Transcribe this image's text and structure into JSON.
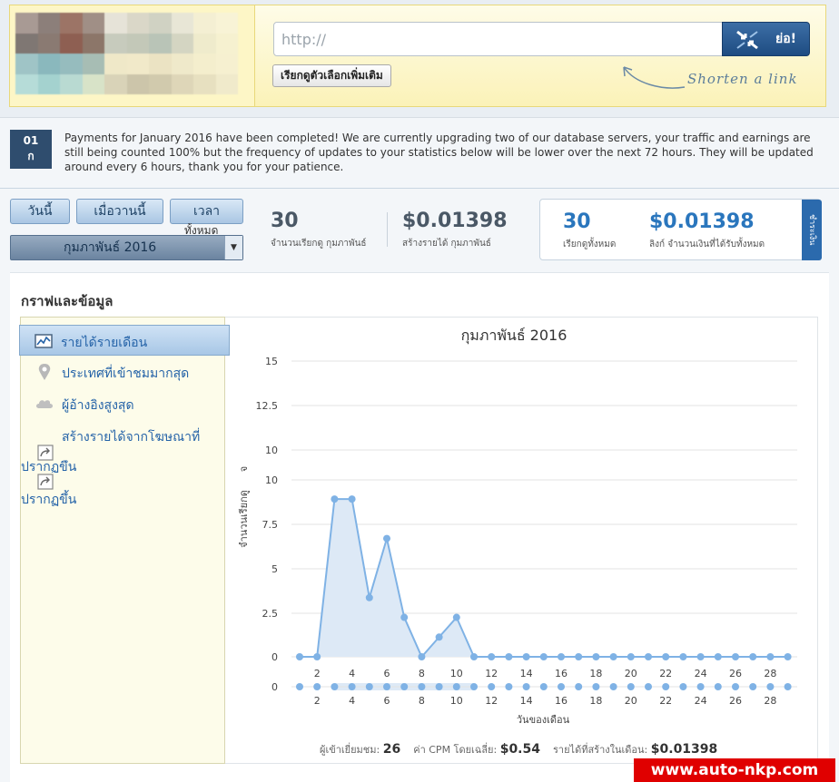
{
  "header": {
    "url_placeholder": "http://",
    "shorten_label": "ย่อ!",
    "more_options_label": "เรียกดูตัวเลือกเพิ่มเติม",
    "hint_text": "Shorten a link"
  },
  "notice": {
    "date_day": "01",
    "date_month": "ก",
    "text": "Payments for January 2016 have been completed! We are currently upgrading two of our database servers, your traffic and earnings are still being counted 100% but the frequency of updates to your statistics below will be lower over the next 72 hours. They will be updated around every 6 hours, thank you for your patience."
  },
  "stats": {
    "tabs": [
      "วันนี้",
      "เมื่อวานนี้",
      "เวลา"
    ],
    "tab_overflow": "ทั้งหมด",
    "month_selected": "กุมภาพันธ์ 2016",
    "month_clicks_value": "30",
    "month_clicks_label": "จำนวนเรียกดู กุมภาพันธ์",
    "month_earn_value": "$0.01398",
    "month_earn_label": "สร้างรายได้ กุมภาพันธ์",
    "total_clicks_value": "30",
    "total_clicks_label": "เรียกดูทั้งหมด",
    "total_earn_value": "$0.01398",
    "total_earn_label": "ลิงก์ จำนวนเงินที่ได้รับทั้งหมด",
    "side_tab_label": "ชำระเงิน"
  },
  "graph": {
    "section_title": "กราฟและข้อมูล",
    "menu": [
      {
        "label": "รายได้รายเดือน",
        "icon": "line-chart-icon"
      },
      {
        "label": "ประเทศที่เข้าชมมากสุด",
        "icon": "map-pin-icon"
      },
      {
        "label": "ผู้อ้างอิงสูงสุด",
        "icon": "cloud-icon"
      },
      {
        "label": "สร้างรายได้จากโฆษณาที่",
        "icon": "share-icon"
      }
    ],
    "menu_overflow_1": "ปรากฏขึ้น",
    "menu_overflow_2": "ปรากฏขึ้น",
    "summary_visitors_label": "ผู้เข้าเยี่ยมชม:",
    "summary_visitors_value": "26",
    "summary_cpm_label": "ค่า CPM โดยเฉลี่ย:",
    "summary_cpm_value": "$0.54",
    "summary_earn_label": "รายได้ที่สร้างในเดือน:",
    "summary_earn_value": "$0.01398"
  },
  "chart_data": {
    "type": "area",
    "title": "กุมภาพันธ์ 2016",
    "xlabel": "วันของเดือน",
    "ylabel": "จำนวนเรียกดู",
    "ylabel_short": "จ",
    "yticks": [
      "15",
      "12.5",
      "10",
      "7.5",
      "5",
      "2.5",
      "0"
    ],
    "ylim": [
      0,
      15
    ],
    "x": [
      1,
      2,
      3,
      4,
      5,
      6,
      7,
      8,
      9,
      10,
      11,
      12,
      13,
      14,
      15,
      16,
      17,
      18,
      19,
      20,
      21,
      22,
      23,
      24,
      25,
      26,
      27,
      28,
      29
    ],
    "values": [
      0,
      0,
      8,
      8,
      3,
      6,
      2,
      0,
      1,
      2,
      0,
      0,
      0,
      0,
      0,
      0,
      0,
      0,
      0,
      0,
      0,
      0,
      0,
      0,
      0,
      0,
      0,
      0,
      0
    ],
    "xticks": [
      "2",
      "4",
      "6",
      "8",
      "10",
      "12",
      "14",
      "16",
      "18",
      "20",
      "22",
      "24",
      "26",
      "28"
    ],
    "navigator_yticks": [
      "10",
      "0"
    ],
    "navigator_values": [
      0,
      0,
      0,
      0,
      0,
      0,
      0,
      0,
      0,
      0,
      0,
      0,
      0,
      0,
      0,
      0,
      0,
      0,
      0,
      0,
      0,
      0,
      0,
      0,
      0,
      0,
      0,
      0,
      0
    ],
    "grid": true,
    "series_color": "#7fb2e5"
  },
  "watermark": "www.auto-nkp.com"
}
